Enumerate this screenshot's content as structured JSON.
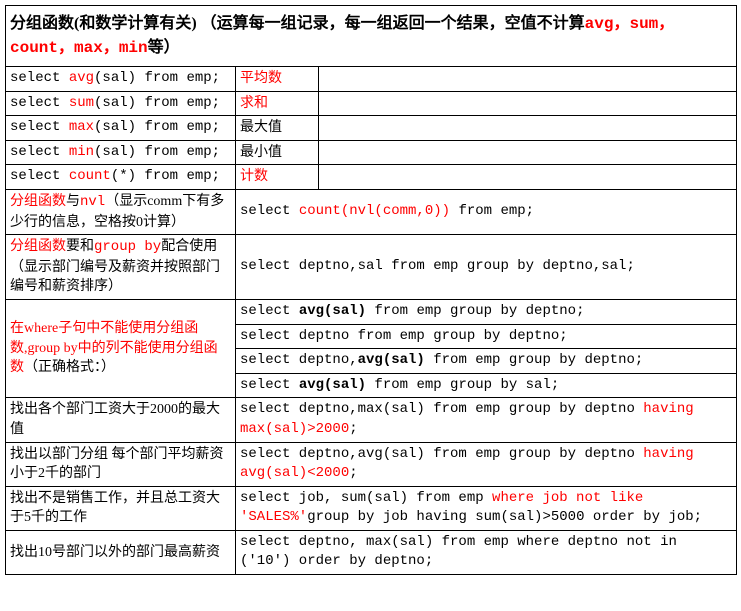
{
  "title": {
    "prefix": "分组函数(和数学计算有关) （运算每一组记录，每一组返回一个结果，空值不计算",
    "funcs": "avg，sum，count，max，min",
    "suffix": "等）"
  },
  "simple": [
    {
      "pre": "select ",
      "fn": "avg",
      "post": "(sal) from emp;",
      "desc": "平均数",
      "dred": true
    },
    {
      "pre": "select ",
      "fn": "sum",
      "post": "(sal) from emp;",
      "desc": "求和",
      "dred": true
    },
    {
      "pre": "select ",
      "fn": "max",
      "post": "(sal) from emp;",
      "desc": "最大值",
      "dred": false
    },
    {
      "pre": "select ",
      "fn": "min",
      "post": "(sal) from emp;",
      "desc": "最小值",
      "dred": false
    },
    {
      "pre": "select ",
      "fn": "count",
      "post": "(*) from emp;",
      "desc": "计数",
      "dred": true
    }
  ],
  "nvl": {
    "left_a": "分组函数",
    "left_b": "与",
    "left_c": "nvl",
    "left_d": "（显示comm下有多少行的信息，空格按0计算）",
    "r_pre": "select ",
    "r_mid": "count(nvl(comm,0))",
    "r_post": " from emp;"
  },
  "groupby": {
    "left_a": "分组函数",
    "left_b": "要和",
    "left_c": "group by",
    "left_d": "配合使用（显示部门编号及薪资并按照部门编号和薪资排序）",
    "right": "select deptno,sal from emp group by deptno,sal;"
  },
  "whereRule": {
    "left_a": "在where子句中不能使用分组函数,group by中的列不能使用分组函数",
    "left_b": "（正确格式：）",
    "rows": [
      {
        "pre": "select ",
        "bold": "avg(sal)",
        "post": " from emp group by deptno;"
      },
      {
        "pre": "",
        "bold": "",
        "post": "select deptno from emp group by deptno;"
      },
      {
        "pre": "select deptno,",
        "bold": "avg(sal)",
        "post": " from emp group by deptno;"
      },
      {
        "pre": "select ",
        "bold": "avg(sal)",
        "post": " from emp group by sal;"
      }
    ]
  },
  "row_gt2000": {
    "left": "找出各个部门工资大于2000的最大值",
    "l1": "select deptno,max(sal) from emp group by deptno ",
    "l2": "having max(sal)>2000",
    "l3": ";"
  },
  "row_avglt2000": {
    "left": "找出以部门分组 每个部门平均薪资小于2千的部门",
    "l1": "select deptno,avg(sal) from emp group by deptno ",
    "l2": "having avg(sal)<2000",
    "l3": ";"
  },
  "row_notsales": {
    "left": "找出不是销售工作，并且总工资大于5千的工作",
    "l1": "select job, sum(sal)  from emp ",
    "l2": "where job not like 'SALES%'",
    "l3": "group by job having sum(sal)>5000 order by job;"
  },
  "row_not10": {
    "left": "找出10号部门以外的部门最高薪资",
    "right": "select deptno, max(sal) from emp where deptno  not in ('10') order by deptno;"
  }
}
